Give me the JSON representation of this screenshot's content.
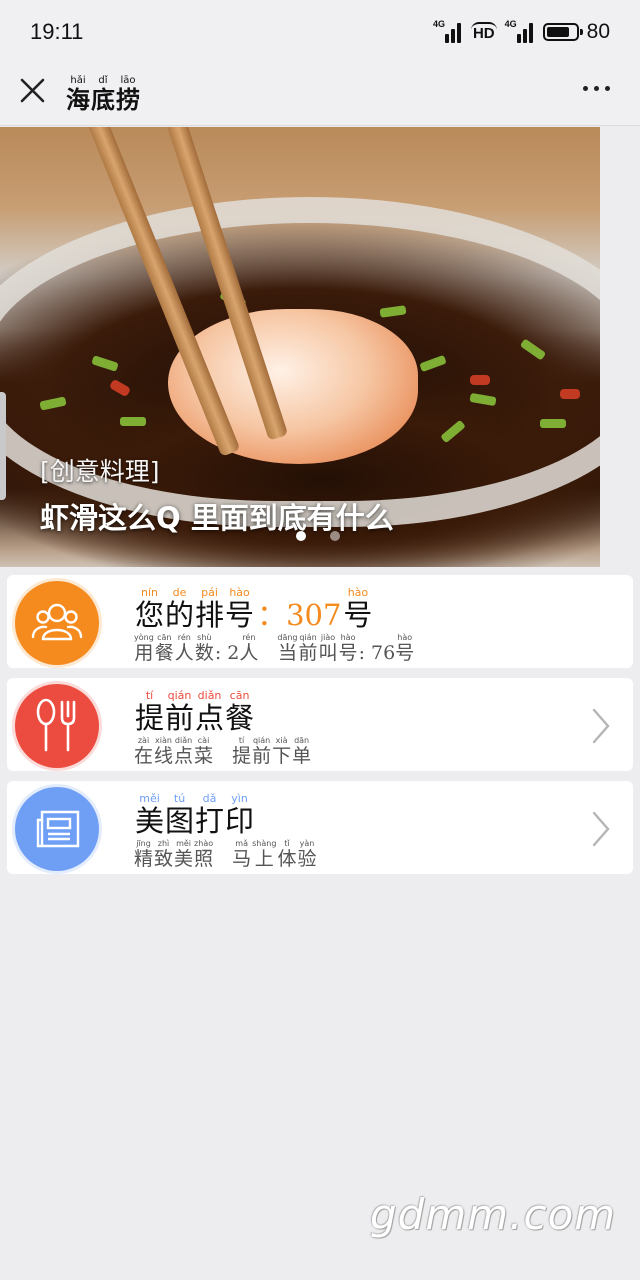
{
  "status_bar": {
    "time": "19:11",
    "network1": "4G",
    "hd": "HD",
    "network2": "4G",
    "battery": "80",
    "battery_level_percent": 80
  },
  "nav": {
    "title": [
      {
        "py": "hǎi",
        "hz": "海"
      },
      {
        "py": "dǐ",
        "hz": "底"
      },
      {
        "py": "lāo",
        "hz": "捞"
      }
    ]
  },
  "banner": {
    "tag": "[创意料理]",
    "caption": "虾滑这么Q 里面到底有什么",
    "active_dot": 0,
    "dot_count": 2
  },
  "cards": [
    {
      "name": "queue-number",
      "color": "#f58a1f",
      "icon": "people-icon",
      "has_chevron": false,
      "title": [
        {
          "py": "nín",
          "hz": "您"
        },
        {
          "py": "de",
          "hz": "的"
        },
        {
          "py": "pái",
          "hz": "排"
        },
        {
          "py": "hào",
          "hz": "号"
        },
        {
          "plain": "：307"
        },
        {
          "py": "hào",
          "hz": "号"
        }
      ],
      "sub": [
        {
          "py": "yòng",
          "hz": "用"
        },
        {
          "py": "cān",
          "hz": "餐"
        },
        {
          "py": "rén",
          "hz": "人"
        },
        {
          "py": "shù",
          "hz": "数"
        },
        {
          "plain": ": 2"
        },
        {
          "py": "rén",
          "hz": "人"
        },
        {
          "gap": true
        },
        {
          "py": "dāng",
          "hz": "当"
        },
        {
          "py": "qián",
          "hz": "前"
        },
        {
          "py": "jiào",
          "hz": "叫"
        },
        {
          "py": "hào",
          "hz": "号"
        },
        {
          "plain": ": 76"
        },
        {
          "py": "hào",
          "hz": "号"
        }
      ]
    },
    {
      "name": "pre-order",
      "color": "#ec4c3f",
      "icon": "spoon-fork-icon",
      "has_chevron": true,
      "title": [
        {
          "py": "tí",
          "hz": "提"
        },
        {
          "py": "qián",
          "hz": "前"
        },
        {
          "py": "diǎn",
          "hz": "点"
        },
        {
          "py": "cān",
          "hz": "餐"
        }
      ],
      "sub": [
        {
          "py": "zài",
          "hz": "在"
        },
        {
          "py": "xiàn",
          "hz": "线"
        },
        {
          "py": "diǎn",
          "hz": "点"
        },
        {
          "py": "cài",
          "hz": "菜"
        },
        {
          "gap": true
        },
        {
          "py": "tí",
          "hz": "提"
        },
        {
          "py": "qián",
          "hz": "前"
        },
        {
          "py": "xià",
          "hz": "下"
        },
        {
          "py": "dān",
          "hz": "单"
        }
      ]
    },
    {
      "name": "photo-print",
      "color": "#6f9ff5",
      "icon": "photo-print-icon",
      "has_chevron": true,
      "title": [
        {
          "py": "měi",
          "hz": "美"
        },
        {
          "py": "tú",
          "hz": "图"
        },
        {
          "py": "dǎ",
          "hz": "打"
        },
        {
          "py": "yìn",
          "hz": "印"
        }
      ],
      "sub": [
        {
          "py": "jīng",
          "hz": "精"
        },
        {
          "py": "zhì",
          "hz": "致"
        },
        {
          "py": "měi",
          "hz": "美"
        },
        {
          "py": "zhào",
          "hz": "照"
        },
        {
          "gap": true
        },
        {
          "py": "mǎ",
          "hz": "马"
        },
        {
          "py": "shàng",
          "hz": "上"
        },
        {
          "py": "tǐ",
          "hz": "体"
        },
        {
          "py": "yàn",
          "hz": "验"
        }
      ]
    }
  ],
  "watermark": "gdmm.com"
}
